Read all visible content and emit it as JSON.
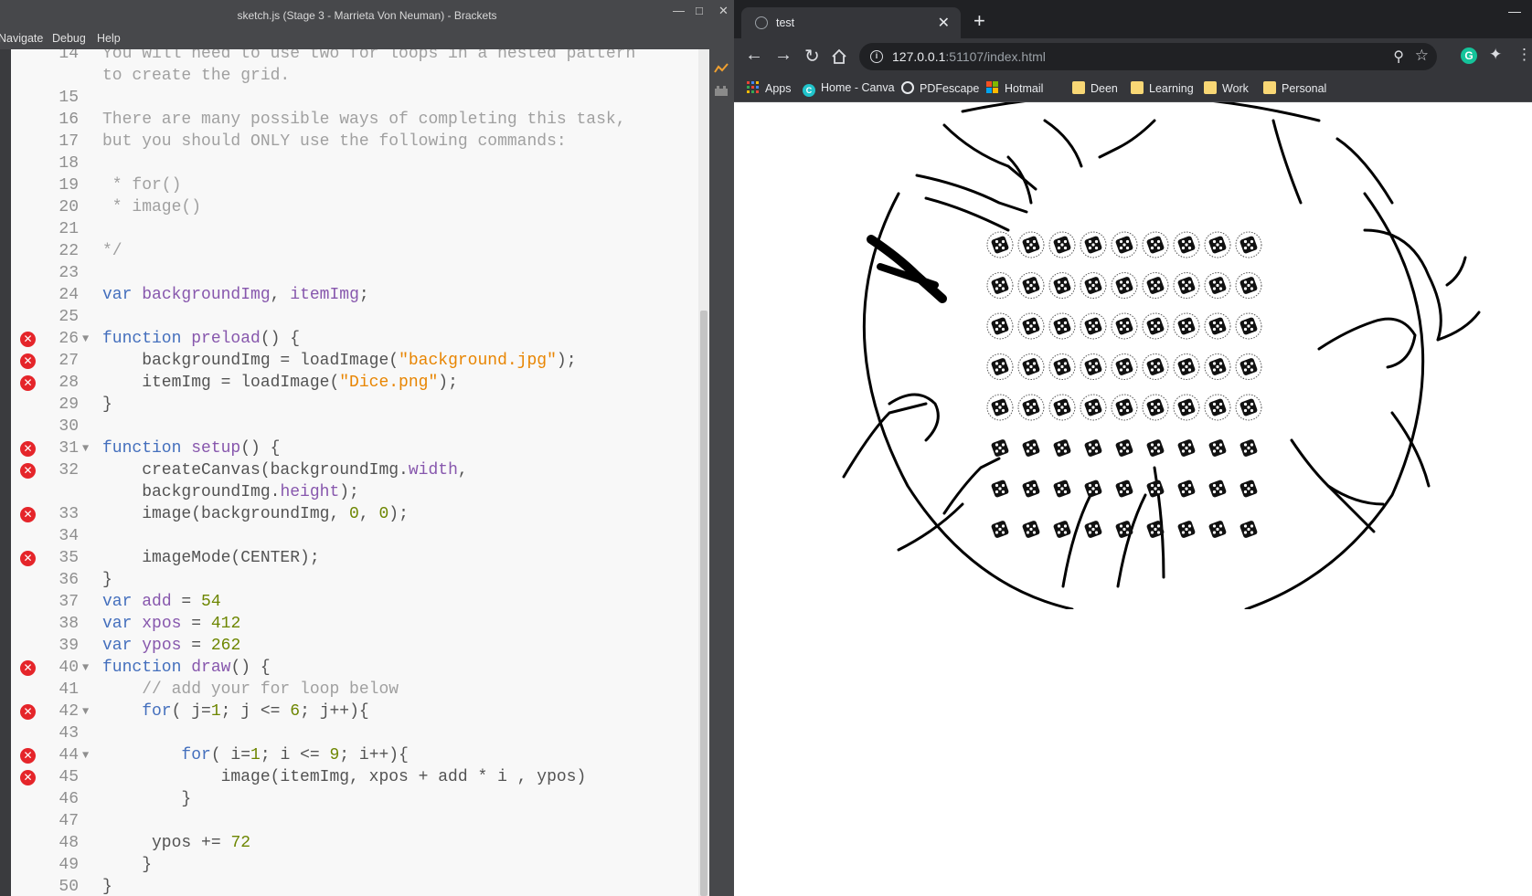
{
  "editor": {
    "title": "sketch.js (Stage 3 - Marrieta Von Neuman) - Brackets",
    "menu": [
      "Navigate",
      "Debug",
      "Help"
    ],
    "lines": [
      {
        "n": "14",
        "err": false,
        "fold": false,
        "tokens": [
          [
            "c-cmt",
            "You will need to use two for loops in a nested pattern"
          ]
        ]
      },
      {
        "n": "",
        "err": false,
        "fold": false,
        "tokens": [
          [
            "c-cmt",
            "to create the grid."
          ]
        ]
      },
      {
        "n": "15",
        "err": false,
        "fold": false,
        "tokens": []
      },
      {
        "n": "16",
        "err": false,
        "fold": false,
        "tokens": [
          [
            "c-cmt",
            "There are many possible ways of completing this task,"
          ]
        ]
      },
      {
        "n": "17",
        "err": false,
        "fold": false,
        "tokens": [
          [
            "c-cmt",
            "but you should ONLY use the following commands:"
          ]
        ]
      },
      {
        "n": "18",
        "err": false,
        "fold": false,
        "tokens": []
      },
      {
        "n": "19",
        "err": false,
        "fold": false,
        "tokens": [
          [
            "c-cmt",
            " * for()"
          ]
        ]
      },
      {
        "n": "20",
        "err": false,
        "fold": false,
        "tokens": [
          [
            "c-cmt",
            " * image()"
          ]
        ]
      },
      {
        "n": "21",
        "err": false,
        "fold": false,
        "tokens": []
      },
      {
        "n": "22",
        "err": false,
        "fold": false,
        "tokens": [
          [
            "c-cmt",
            "*/"
          ]
        ]
      },
      {
        "n": "23",
        "err": false,
        "fold": false,
        "tokens": []
      },
      {
        "n": "24",
        "err": false,
        "fold": false,
        "tokens": [
          [
            "c-kw",
            "var "
          ],
          [
            "c-def",
            "backgroundImg"
          ],
          [
            "",
            ", "
          ],
          [
            "c-def",
            "itemImg"
          ],
          [
            "",
            ";"
          ]
        ]
      },
      {
        "n": "25",
        "err": false,
        "fold": false,
        "tokens": []
      },
      {
        "n": "26",
        "err": true,
        "fold": true,
        "tokens": [
          [
            "c-kw",
            "function "
          ],
          [
            "c-def",
            "preload"
          ],
          [
            "",
            "() {"
          ]
        ]
      },
      {
        "n": "27",
        "err": true,
        "fold": false,
        "tokens": [
          [
            "",
            "    backgroundImg = loadImage("
          ],
          [
            "c-str",
            "\"background.jpg\""
          ],
          [
            "",
            ");"
          ]
        ]
      },
      {
        "n": "28",
        "err": true,
        "fold": false,
        "tokens": [
          [
            "",
            "    itemImg = loadImage("
          ],
          [
            "c-str",
            "\"Dice.png\""
          ],
          [
            "",
            ");"
          ]
        ]
      },
      {
        "n": "29",
        "err": false,
        "fold": false,
        "tokens": [
          [
            "",
            "}"
          ]
        ]
      },
      {
        "n": "30",
        "err": false,
        "fold": false,
        "tokens": []
      },
      {
        "n": "31",
        "err": true,
        "fold": true,
        "tokens": [
          [
            "c-kw",
            "function "
          ],
          [
            "c-def",
            "setup"
          ],
          [
            "",
            "() {"
          ]
        ]
      },
      {
        "n": "32",
        "err": true,
        "fold": false,
        "tokens": [
          [
            "",
            "    createCanvas(backgroundImg."
          ],
          [
            "c-prop",
            "width"
          ],
          [
            "",
            ","
          ]
        ]
      },
      {
        "n": "",
        "err": false,
        "fold": false,
        "tokens": [
          [
            "",
            "    backgroundImg."
          ],
          [
            "c-prop",
            "height"
          ],
          [
            "",
            ");"
          ]
        ]
      },
      {
        "n": "33",
        "err": true,
        "fold": false,
        "tokens": [
          [
            "",
            "    image(backgroundImg, "
          ],
          [
            "c-num",
            "0"
          ],
          [
            "",
            ", "
          ],
          [
            "c-num",
            "0"
          ],
          [
            "",
            ");"
          ]
        ]
      },
      {
        "n": "34",
        "err": false,
        "fold": false,
        "tokens": []
      },
      {
        "n": "35",
        "err": true,
        "fold": false,
        "tokens": [
          [
            "",
            "    imageMode(CENTER);"
          ]
        ]
      },
      {
        "n": "36",
        "err": false,
        "fold": false,
        "tokens": [
          [
            "",
            "}"
          ]
        ]
      },
      {
        "n": "37",
        "err": false,
        "fold": false,
        "tokens": [
          [
            "c-kw",
            "var "
          ],
          [
            "c-def",
            "add"
          ],
          [
            "",
            " = "
          ],
          [
            "c-num",
            "54"
          ]
        ]
      },
      {
        "n": "38",
        "err": false,
        "fold": false,
        "tokens": [
          [
            "c-kw",
            "var "
          ],
          [
            "c-def",
            "xpos"
          ],
          [
            "",
            " = "
          ],
          [
            "c-num",
            "412"
          ]
        ]
      },
      {
        "n": "39",
        "err": false,
        "fold": false,
        "tokens": [
          [
            "c-kw",
            "var "
          ],
          [
            "c-def",
            "ypos"
          ],
          [
            "",
            " = "
          ],
          [
            "c-num",
            "262"
          ]
        ]
      },
      {
        "n": "40",
        "err": true,
        "fold": true,
        "tokens": [
          [
            "c-kw",
            "function "
          ],
          [
            "c-def",
            "draw"
          ],
          [
            "",
            "() {"
          ]
        ]
      },
      {
        "n": "41",
        "err": false,
        "fold": false,
        "tokens": [
          [
            "c-cmt",
            "    // add your for loop below"
          ]
        ]
      },
      {
        "n": "42",
        "err": true,
        "fold": true,
        "tokens": [
          [
            "c-kw",
            "    for"
          ],
          [
            "",
            "( j="
          ],
          [
            "c-num",
            "1"
          ],
          [
            "",
            "; j <= "
          ],
          [
            "c-num",
            "6"
          ],
          [
            "",
            "; j++){"
          ]
        ]
      },
      {
        "n": "43",
        "err": false,
        "fold": false,
        "tokens": []
      },
      {
        "n": "44",
        "err": true,
        "fold": true,
        "tokens": [
          [
            "c-kw",
            "        for"
          ],
          [
            "",
            "( i="
          ],
          [
            "c-num",
            "1"
          ],
          [
            "",
            "; i <= "
          ],
          [
            "c-num",
            "9"
          ],
          [
            "",
            "; i++){"
          ]
        ]
      },
      {
        "n": "45",
        "err": true,
        "fold": false,
        "tokens": [
          [
            "",
            "            image(itemImg, xpos + add * i , ypos)"
          ]
        ]
      },
      {
        "n": "46",
        "err": false,
        "fold": false,
        "tokens": [
          [
            "",
            "        }"
          ]
        ]
      },
      {
        "n": "47",
        "err": false,
        "fold": false,
        "tokens": []
      },
      {
        "n": "48",
        "err": false,
        "fold": false,
        "tokens": [
          [
            "",
            "     ypos += "
          ],
          [
            "c-num",
            "72"
          ]
        ]
      },
      {
        "n": "49",
        "err": false,
        "fold": false,
        "tokens": [
          [
            "",
            "    }"
          ]
        ]
      },
      {
        "n": "50",
        "err": false,
        "fold": false,
        "tokens": [
          [
            "",
            "}"
          ]
        ]
      }
    ]
  },
  "browser": {
    "tab_title": "test",
    "url_host": "127.0.0.1",
    "url_rest": ":51107/index.html",
    "bookmarks": [
      {
        "label": "Apps",
        "icon": "apps-icon"
      },
      {
        "label": "Home - Canva",
        "icon": "canva-icon"
      },
      {
        "label": "PDFescape",
        "icon": "pdfescape-icon"
      },
      {
        "label": "Hotmail",
        "icon": "microsoft-icon"
      },
      {
        "label": "Deen",
        "icon": "folder-icon"
      },
      {
        "label": "Learning",
        "icon": "folder-icon"
      },
      {
        "label": "Work",
        "icon": "folder-icon"
      },
      {
        "label": "Personal",
        "icon": "folder-icon"
      }
    ],
    "canvas": {
      "dice_rows": 8,
      "dice_cols": 9,
      "background_description_icon": "hands-around-table-drawing"
    }
  }
}
